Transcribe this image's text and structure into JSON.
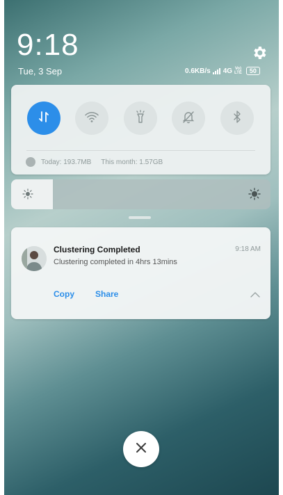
{
  "status_bar": {
    "time": "9:18",
    "date": "Tue, 3 Sep",
    "network_speed": "0.6KB/s",
    "network_type": "4G",
    "volte_top": "Vo)",
    "volte_bottom": "LTE",
    "battery": "50"
  },
  "quick_settings": {
    "toggles": [
      {
        "name": "mobile-data",
        "icon": "mobile-data-arrows-icon",
        "active": true
      },
      {
        "name": "wifi",
        "icon": "wifi-icon",
        "active": false
      },
      {
        "name": "flashlight",
        "icon": "flashlight-icon",
        "active": false
      },
      {
        "name": "silent",
        "icon": "bell-off-icon",
        "active": false
      },
      {
        "name": "bluetooth",
        "icon": "bluetooth-icon",
        "active": false
      }
    ],
    "data_usage": {
      "today": "Today: 193.7MB",
      "month": "This month: 1.57GB"
    }
  },
  "brightness": {
    "level": 0.16
  },
  "notification": {
    "title": "Clustering Completed",
    "time": "9:18 AM",
    "body": "Clustering completed in 4hrs 13mins",
    "actions": [
      "Copy",
      "Share"
    ]
  },
  "colors": {
    "accent": "#2c8ee9"
  }
}
